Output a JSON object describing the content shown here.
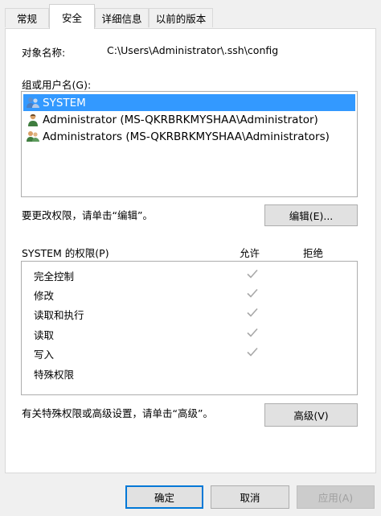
{
  "tabs": [
    {
      "label": "常规"
    },
    {
      "label": "安全"
    },
    {
      "label": "详细信息"
    },
    {
      "label": "以前的版本"
    }
  ],
  "object_name": {
    "label": "对象名称:",
    "value": "C:\\Users\\Administrator\\.ssh\\config"
  },
  "groups": {
    "label": "组或用户名(G):",
    "items": [
      {
        "name": "SYSTEM",
        "icon": "users-group-icon",
        "selected": true
      },
      {
        "name": "Administrator (MS-QKRBRKMYSHAA\\Administrator)",
        "icon": "user-icon",
        "selected": false
      },
      {
        "name": "Administrators (MS-QKRBRKMYSHAA\\Administrators)",
        "icon": "users-group-icon",
        "selected": false
      }
    ]
  },
  "edit": {
    "hint": "要更改权限，请单击“编辑”。",
    "button": "编辑(E)..."
  },
  "permissions": {
    "title": "SYSTEM 的权限(P)",
    "allow_header": "允许",
    "deny_header": "拒绝",
    "rows": [
      {
        "name": "完全控制",
        "allow": true,
        "deny": false
      },
      {
        "name": "修改",
        "allow": true,
        "deny": false
      },
      {
        "name": "读取和执行",
        "allow": true,
        "deny": false
      },
      {
        "name": "读取",
        "allow": true,
        "deny": false
      },
      {
        "name": "写入",
        "allow": true,
        "deny": false
      },
      {
        "name": "特殊权限",
        "allow": false,
        "deny": false
      }
    ]
  },
  "advanced": {
    "hint": "有关特殊权限或高级设置，请单击“高级”。",
    "button": "高级(V)"
  },
  "footer": {
    "ok": "确定",
    "cancel": "取消",
    "apply": "应用(A)"
  },
  "colors": {
    "selection": "#3399ff",
    "check": "#a8a8a8",
    "accent": "#0078d7"
  }
}
